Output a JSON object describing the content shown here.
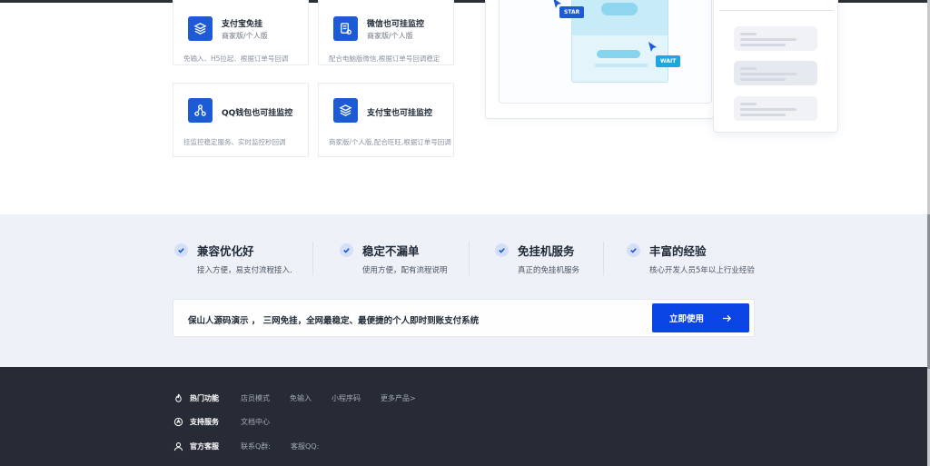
{
  "features": [
    {
      "title": "支付宝免挂",
      "sub": "商家版/个人版",
      "desc": "免输入、H5拉起、根据订单号回调",
      "icon": "layers-icon"
    },
    {
      "title": "微信也可挂监控",
      "sub": "商家版/个人版",
      "desc": "配合电脑版微信,根据订单号回调稳定",
      "icon": "document-icon"
    },
    {
      "title": "QQ钱包也可挂监控",
      "sub": "",
      "desc": "挂监控稳定服务、实时监控秒回调",
      "icon": "network-icon"
    },
    {
      "title": "支付宝也可挂监控",
      "sub": "",
      "desc": "商家版/个人版,配合旺旺,根据订单号回调",
      "icon": "layers-icon"
    }
  ],
  "illustration": {
    "star_tag": "STAR",
    "wait_tag": "WAIT"
  },
  "advantages": [
    {
      "title": "兼容优化好",
      "desc": "接入方便，易支付流程接入."
    },
    {
      "title": "稳定不漏单",
      "desc": "使用方便，配有流程说明"
    },
    {
      "title": "免挂机服务",
      "desc": "真正的免挂机服务"
    },
    {
      "title": "丰富的经验",
      "desc": "核心开发人员5年以上行业经验"
    }
  ],
  "cta": {
    "text": "保山人源码演示 ， 三网免挂，全网最稳定、最便捷的个人即时到账支付系统",
    "button": "立即使用"
  },
  "footer": {
    "rows": [
      {
        "head": "热门功能",
        "icon": "fire-icon",
        "links": [
          "店员模式",
          "免输入",
          "小程序码",
          "更多产品>"
        ]
      },
      {
        "head": "支持服务",
        "icon": "service-icon",
        "links": [
          "文档中心"
        ]
      },
      {
        "head": "官方客服",
        "icon": "user-icon",
        "links": [
          "联系Q群:",
          "客服QQ:"
        ]
      }
    ]
  },
  "colors": {
    "primary": "#0a44e4",
    "icon_bg": "#1d5bd6",
    "footer_bg": "#272b36",
    "band_bg": "#eef1f8"
  }
}
